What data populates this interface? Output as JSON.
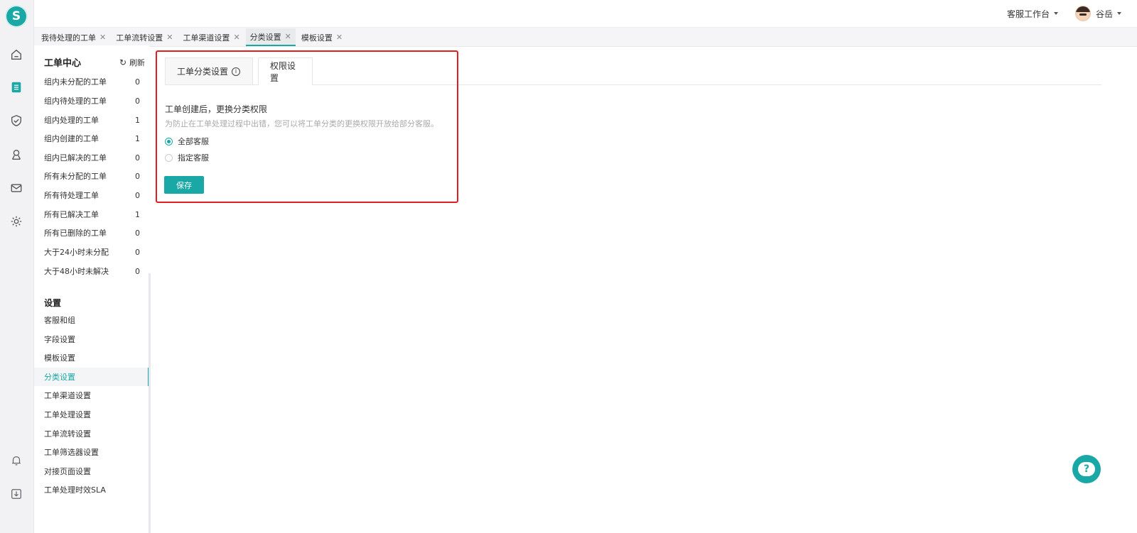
{
  "app": {
    "logo_letter": "S",
    "accent_color": "#1aa8a6"
  },
  "rail": {
    "icons": [
      "home-icon",
      "ticket-list-icon",
      "shield-check-icon",
      "user-badge-icon",
      "mail-icon",
      "gear-icon",
      "bell-icon",
      "download-icon"
    ]
  },
  "header": {
    "workbench_label": "客服工作台",
    "user_name": "谷岳"
  },
  "page_tabs": [
    {
      "label": "我待处理的工单"
    },
    {
      "label": "工单流转设置"
    },
    {
      "label": "工单渠道设置"
    },
    {
      "label": "分类设置"
    },
    {
      "label": "模板设置"
    }
  ],
  "sidebar": {
    "title": "工单中心",
    "refresh_label": "刷新",
    "items": [
      {
        "label": "组内未分配的工单",
        "count": "0"
      },
      {
        "label": "组内待处理的工单",
        "count": "0"
      },
      {
        "label": "组内处理的工单",
        "count": "1"
      },
      {
        "label": "组内创建的工单",
        "count": "1"
      },
      {
        "label": "组内已解决的工单",
        "count": "0"
      },
      {
        "label": "所有未分配的工单",
        "count": "0"
      },
      {
        "label": "所有待处理工单",
        "count": "0"
      },
      {
        "label": "所有已解决工单",
        "count": "1"
      },
      {
        "label": "所有已删除的工单",
        "count": "0"
      },
      {
        "label": "大于24小时未分配",
        "count": "0"
      },
      {
        "label": "大于48小时未解决",
        "count": "0"
      }
    ],
    "settings_title": "设置",
    "settings_items": [
      {
        "label": "客服和组"
      },
      {
        "label": "字段设置"
      },
      {
        "label": "模板设置"
      },
      {
        "label": "分类设置"
      },
      {
        "label": "工单渠道设置"
      },
      {
        "label": "工单处理设置"
      },
      {
        "label": "工单流转设置"
      },
      {
        "label": "工单筛选器设置"
      },
      {
        "label": "对接页面设置"
      },
      {
        "label": "工单处理时效SLA"
      }
    ]
  },
  "main": {
    "tabs": [
      {
        "label": "工单分类设置"
      },
      {
        "label": "权限设置"
      }
    ],
    "section_title": "工单创建后，更换分类权限",
    "section_desc": "为防止在工单处理过程中出错，您可以将工单分类的更换权限开放给部分客服。",
    "options": [
      {
        "label": "全部客服",
        "checked": true
      },
      {
        "label": "指定客服",
        "checked": false
      }
    ],
    "save_label": "保存"
  }
}
